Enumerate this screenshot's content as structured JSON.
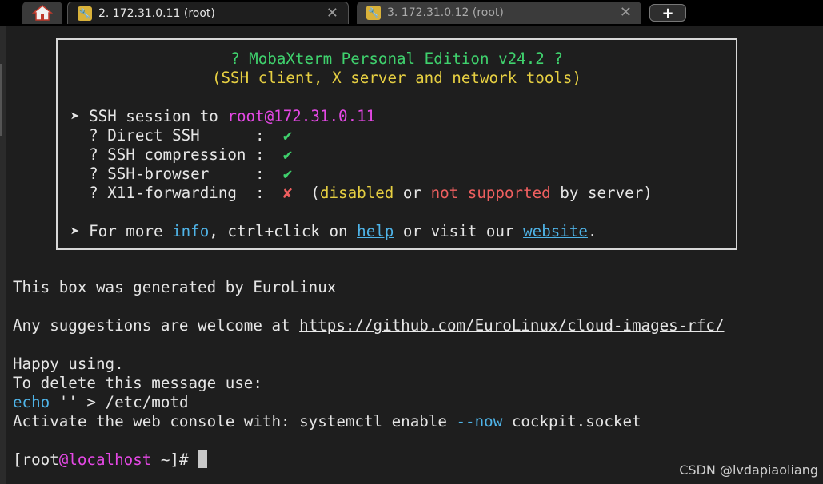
{
  "tabs": {
    "home_icon": "house-icon",
    "active": {
      "label": "2. 172.31.0.11 (root)",
      "close": "✕"
    },
    "inactive": {
      "label": "3. 172.31.0.12 (root)",
      "close": "✕"
    },
    "new_tab": "+"
  },
  "banner": {
    "title": "? MobaXterm Personal Edition v24.2 ?",
    "subtitle": "(SSH client, X server and network tools)",
    "session_prefix": "➤ SSH session to ",
    "session_target": "root@172.31.0.11",
    "items": [
      {
        "label": "  ? Direct SSH      :  ",
        "status": "✔"
      },
      {
        "label": "  ? SSH compression :  ",
        "status": "✔"
      },
      {
        "label": "  ? SSH-browser     :  ",
        "status": "✔"
      }
    ],
    "x11": {
      "label": "  ? X11-forwarding  :  ",
      "status": "✘",
      "p1": "  (",
      "disabled": "disabled",
      "p2": " or ",
      "not_supported": "not supported",
      "p3": " by server)"
    },
    "more": {
      "p1": "➤ For more ",
      "info": "info",
      "p2": ", ctrl+click on ",
      "help": "help",
      "p3": " or visit our ",
      "website": "website",
      "p4": "."
    }
  },
  "motd": {
    "generated": "This box was generated by EuroLinux",
    "suggest_prefix": "Any suggestions are welcome at ",
    "suggest_url": "https://github.com/EuroLinux/cloud-images-rfc/",
    "happy": "Happy using.",
    "delete": "To delete this message use:",
    "echo_cmd": "echo",
    "echo_rest": " '' > /etc/motd",
    "activate_prefix": "Activate the web console with: systemctl enable ",
    "activate_flag": "--now",
    "activate_suffix": " cockpit.socket"
  },
  "prompt": {
    "open": "[root",
    "at": "@",
    "host": "localhost",
    "rest": " ~]# "
  },
  "watermark": "CSDN @lvdapiaoliang",
  "colors": {
    "background": "#1e1e1e",
    "green": "#3fd16d",
    "yellow": "#e6cf42",
    "magenta": "#e548e5",
    "red": "#ef5f5f",
    "cyan": "#4fb4e8"
  }
}
